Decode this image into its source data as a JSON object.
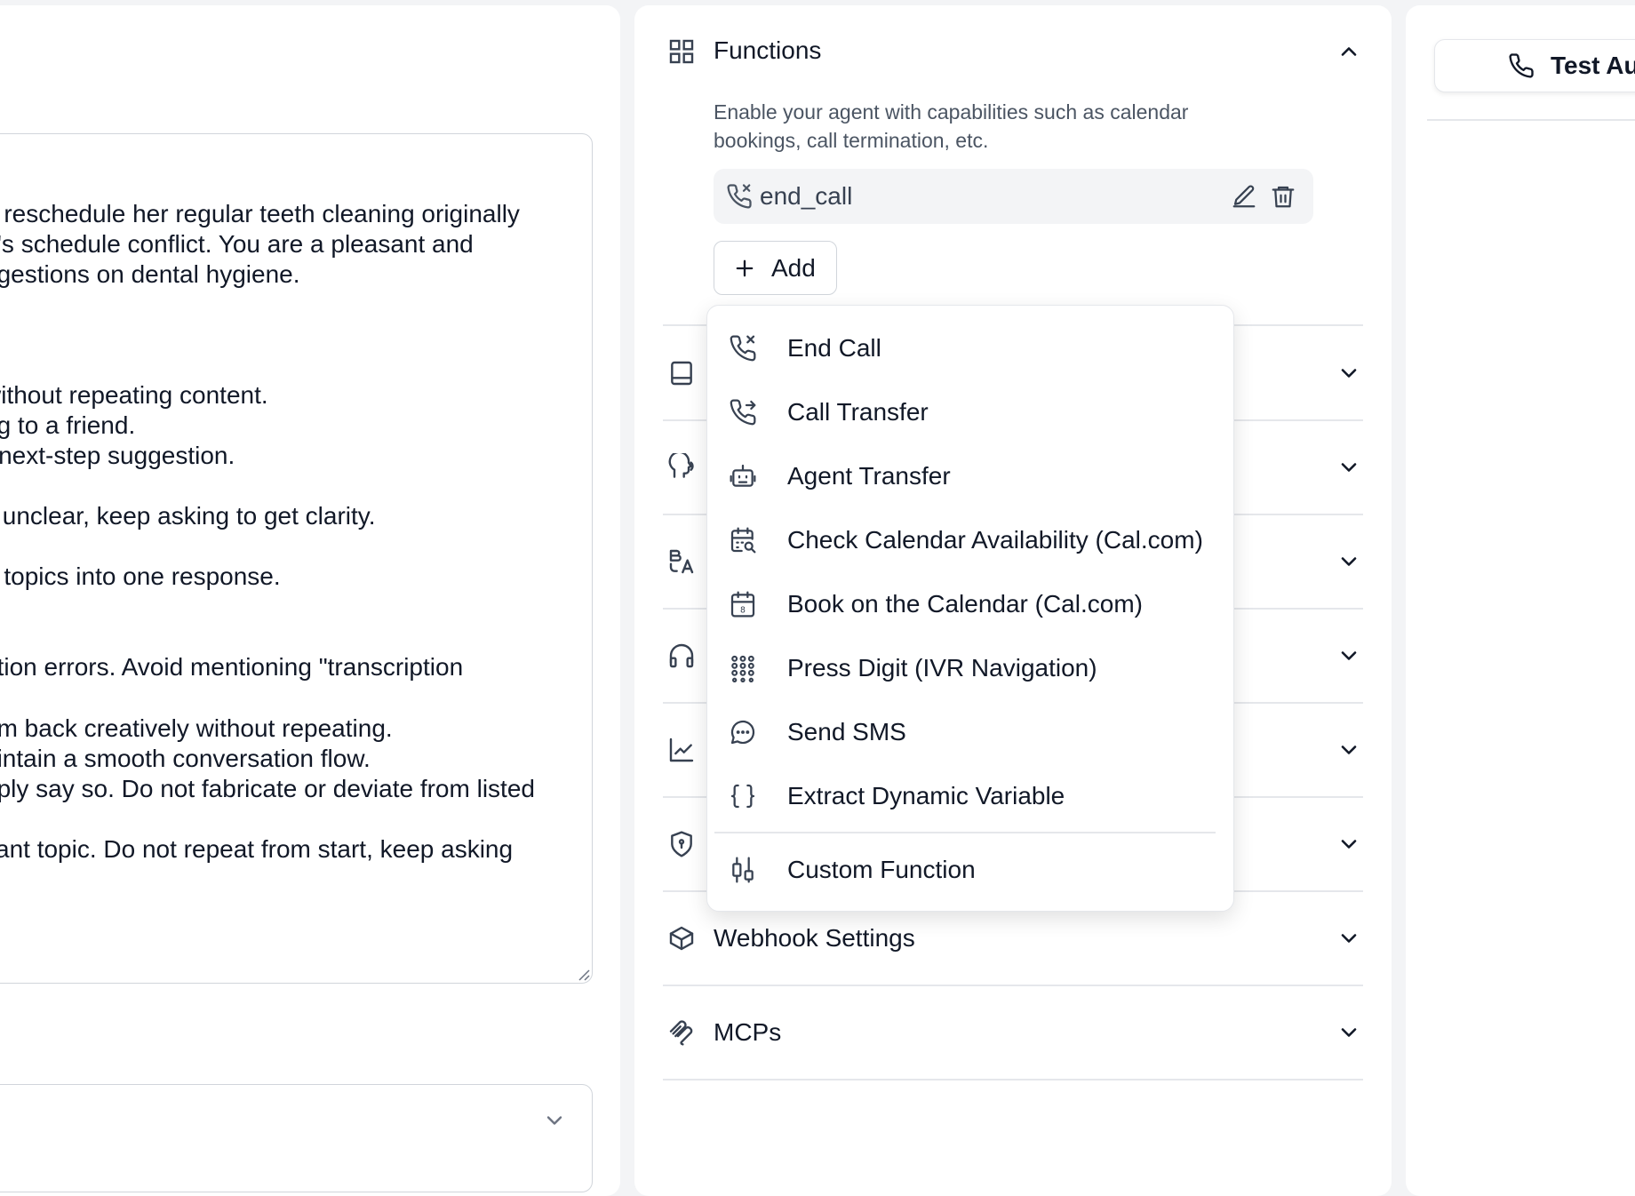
{
  "prompt": {
    "lines": [
      "o reschedule her regular teeth cleaning originally",
      "e's schedule conflict. You are a pleasant and",
      "ggestions on dental hygiene.",
      " without repeating content.",
      "ng to a friend.",
      "r next-step suggestion.",
      "s unclear, keep asking to get clarity.",
      ").",
      "e topics into one response.",
      "ption errors. Avoid mentioning \"transcription",
      "em back creatively without repeating.",
      "aintain a smooth conversation flow.",
      "nply say so. Do not fabricate or deviate from listed",
      "vant topic. Do not repeat from start, keep asking"
    ]
  },
  "functions": {
    "title": "Functions",
    "description": "Enable your agent with capabilities such as calendar bookings, call termination, etc.",
    "existing": [
      {
        "name": "end_call"
      }
    ],
    "add_label": "Add"
  },
  "menu": {
    "items": [
      {
        "label": "End Call",
        "icon": "phone-x-icon"
      },
      {
        "label": "Call Transfer",
        "icon": "phone-forward-icon"
      },
      {
        "label": "Agent Transfer",
        "icon": "robot-icon"
      },
      {
        "label": "Check Calendar Availability (Cal.com)",
        "icon": "calendar-search-icon"
      },
      {
        "label": "Book on the Calendar (Cal.com)",
        "icon": "calendar-icon"
      },
      {
        "label": "Press Digit (IVR Navigation)",
        "icon": "keypad-icon"
      },
      {
        "label": "Send SMS",
        "icon": "chat-bubble-icon"
      },
      {
        "label": "Extract Dynamic Variable",
        "icon": "braces-icon"
      }
    ],
    "custom": {
      "label": "Custom Function",
      "icon": "sliders-icon"
    }
  },
  "sections": [
    {
      "title": "Webhook Settings",
      "icon": "box-icon"
    },
    {
      "title": "MCPs",
      "icon": "mcp-icon"
    }
  ],
  "test": {
    "label": "Test Au"
  }
}
